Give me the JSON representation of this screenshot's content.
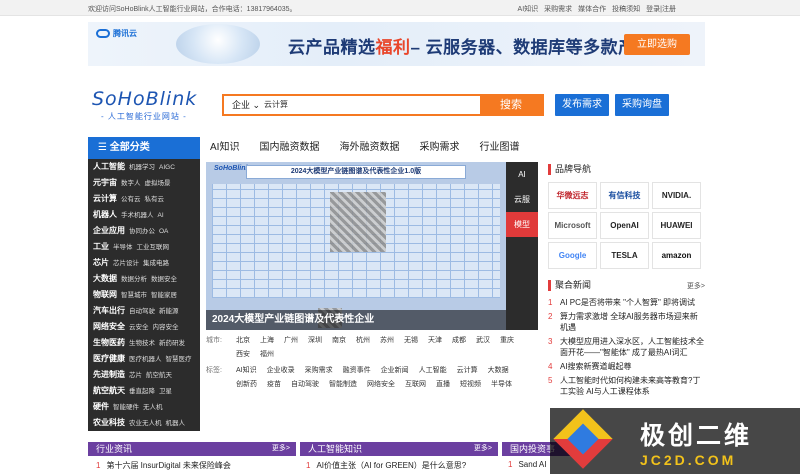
{
  "topbar": {
    "welcome": "欢迎访问SoHoBlink人工智能行业网站，合作电话：13817964035。",
    "links": [
      "AI知识",
      "采购需求",
      "媒体合作",
      "投稿须知",
      "登录|注册"
    ]
  },
  "ad": {
    "logo": "腾讯云",
    "headline_pre": "云产品精选",
    "headline_hl": "福利",
    "headline_post": "– 云服务器、数据库等多款产品特惠",
    "cta": "立即选购"
  },
  "brand": {
    "name": "SoHoBlink",
    "sub": "- 人工智能行业网站 -"
  },
  "search": {
    "category": "企业",
    "value": "云计算",
    "button": "搜索"
  },
  "buttons": {
    "publish": "发布需求",
    "purchase": "采购询盘"
  },
  "all_categories": "全部分类",
  "main_nav": [
    "AI知识",
    "国内融资数据",
    "海外融资数据",
    "采购需求",
    "行业图谱"
  ],
  "categories": [
    {
      "name": "人工智能",
      "subs": [
        "机器学习",
        "AIGC"
      ]
    },
    {
      "name": "元宇宙",
      "subs": [
        "数字人",
        "虚拟场景"
      ]
    },
    {
      "name": "云计算",
      "subs": [
        "公有云",
        "私有云"
      ]
    },
    {
      "name": "机器人",
      "subs": [
        "手术机器人",
        "AI"
      ]
    },
    {
      "name": "企业应用",
      "subs": [
        "协同办公",
        "OA"
      ]
    },
    {
      "name": "工业",
      "subs": [
        "半导体",
        "工业互联网"
      ]
    },
    {
      "name": "芯片",
      "subs": [
        "芯片设计",
        "集成电路"
      ]
    },
    {
      "name": "大数据",
      "subs": [
        "数据分析",
        "数据安全"
      ]
    },
    {
      "name": "物联网",
      "subs": [
        "智慧城市",
        "智能家居"
      ]
    },
    {
      "name": "汽车出行",
      "subs": [
        "自动驾驶",
        "新能源"
      ]
    },
    {
      "name": "网络安全",
      "subs": [
        "云安全",
        "内容安全"
      ]
    },
    {
      "name": "生物医药",
      "subs": [
        "生物技术",
        "新药研发"
      ]
    },
    {
      "name": "医疗健康",
      "subs": [
        "医疗机器人",
        "智慧医疗"
      ]
    },
    {
      "name": "先进制造",
      "subs": [
        "芯片",
        "航空航天"
      ]
    },
    {
      "name": "航空航天",
      "subs": [
        "垂直起降",
        "卫星"
      ]
    },
    {
      "name": "硬件",
      "subs": [
        "智能硬件",
        "无人机"
      ]
    },
    {
      "name": "农业科技",
      "subs": [
        "农业无人机",
        "机器人"
      ]
    }
  ],
  "banner": {
    "mini_logo": "SoHoBlink",
    "strip_title": "2024大模型产业链图谱及代表性企业1.0版",
    "caption": "2024大模型产业链图谱及代表性企业"
  },
  "vtabs": [
    {
      "label": "AI",
      "active": false
    },
    {
      "label": "云服",
      "active": false
    },
    {
      "label": "模型",
      "active": true
    }
  ],
  "meta": {
    "city_label": "城市:",
    "cities": [
      "北京",
      "上海",
      "广州",
      "深圳",
      "南京",
      "杭州",
      "苏州",
      "无锡",
      "天津",
      "成都",
      "武汉",
      "重庆",
      "西安",
      "福州"
    ],
    "tag_label": "标签:",
    "tags": [
      "AI知识",
      "企业收录",
      "采购需求",
      "融资事件",
      "企业新闻",
      "人工智能",
      "云计算",
      "大数据",
      "创新药",
      "疫苗",
      "自动驾驶",
      "智能制造",
      "网络安全",
      "互联网",
      "直播",
      "短视频",
      "半导体"
    ]
  },
  "brand_nav": {
    "title": "品牌导航",
    "logos": [
      {
        "label": "华微远志",
        "color": "#c0262d"
      },
      {
        "label": "有信科技",
        "color": "#1a4ea0"
      },
      {
        "label": "NVIDIA.",
        "color": "#222222"
      },
      {
        "label": "Microsoft",
        "color": "#555555"
      },
      {
        "label": "OpenAI",
        "color": "#222222"
      },
      {
        "label": "HUAWEI",
        "color": "#222222"
      },
      {
        "label": "Google",
        "color": "#4285f4"
      },
      {
        "label": "TESLA",
        "color": "#222222"
      },
      {
        "label": "amazon",
        "color": "#111111"
      }
    ]
  },
  "news": {
    "title": "聚合新闻",
    "more": "更多>",
    "items": [
      "AI PC是否将带来 \"个人智算\" 即将调试",
      "算力需求激增 全球AI服务器市场迎来新机遇",
      "大模型应用进入深水区，人工智能技术全面开花——\"智能体\" 成了最热AI词汇",
      "AI搜索新赛道崛起尊",
      "人工智能时代如何构建未来高等教育?丁工实验 AI与人工课程体系"
    ]
  },
  "bottom": [
    {
      "title": "行业资讯",
      "more": "更多>",
      "item_no": "1",
      "item": "第十六届 InsurDigital 未来保险峰会",
      "color": "#6b3fa0"
    },
    {
      "title": "人工智能知识",
      "more": "更多>",
      "item_no": "1",
      "item": "AI价值主张（AI for GREEN）是什么意思?",
      "color": "#6b3fa0"
    },
    {
      "title": "国内投资事",
      "more": "",
      "item_no": "1",
      "item": "Sand AI",
      "color": "#6b3fa0"
    }
  ],
  "watermark": {
    "text": "极创二维",
    "url": "JC2D.COM"
  }
}
